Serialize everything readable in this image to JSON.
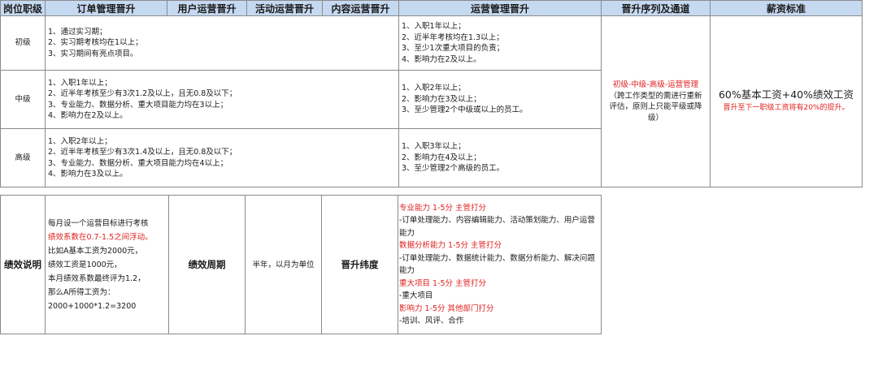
{
  "table1": {
    "headers": [
      "岗位职级",
      "订单管理晋升",
      "用户运营晋升",
      "活动运营晋升",
      "内容运营晋升",
      "运营管理晋升",
      "晋升序列及通道",
      "薪资标准"
    ],
    "rows": [
      {
        "level": "初级",
        "left": [
          "1、通过实习期；",
          "2、实习期考核均在1以上；",
          "3、实习期间有亮点项目。"
        ],
        "right": [
          "1、入职1年以上；",
          "2、近半年考核均在1.3以上；",
          "3、至少1次重大项目的负责；",
          "4、影响力在2及以上。"
        ]
      },
      {
        "level": "中级",
        "left": [
          "1、入职1年以上；",
          "2、近半年考核至少有3次1.2及以上，且无0.8及以下；",
          "3、专业能力、数据分析、重大项目能力均在3以上；",
          "4、影响力在2及以上。"
        ],
        "right": [
          "1、入职2年以上；",
          "2、影响力在3及以上；",
          "3、至少管理2个中级或以上的员工。"
        ]
      },
      {
        "level": "高级",
        "left": [
          "1、入职2年以上；",
          "2、近半年考核至少有3次1.4及以上，且无0.8及以下；",
          "3、专业能力、数据分析、重大项目能力均在4以上；",
          "4、影响力在3及以上。"
        ],
        "right": [
          "1、入职3年以上；",
          "2、影响力在4及以上；",
          "3、至少管理2个高级的员工。"
        ]
      }
    ],
    "path": {
      "title": "初级-中级-高级-运营管理",
      "note": "（跨工作类型的需进行重新评估，原则上只能平级或降级）"
    },
    "salary": {
      "main": "60%基本工资+40%绩效工资",
      "sub": "晋升至下一职级工资将有20%的提升。"
    }
  },
  "table2": {
    "label": "绩效说明",
    "desc": [
      {
        "text": "每月设一个运营目标进行考核",
        "color": "#1a1a1a"
      },
      {
        "text": "绩效系数在0.7-1.5之间浮动。",
        "color": "#e02020"
      },
      {
        "text": "比如A基本工资为2000元，",
        "color": "#1a1a1a"
      },
      {
        "text": "绩效工资是1000元，",
        "color": "#1a1a1a"
      },
      {
        "text": "本月绩效系数最终评为1.2，",
        "color": "#1a1a1a"
      },
      {
        "text": "那么A所得工资为：",
        "color": "#1a1a1a"
      },
      {
        "text": "2000+1000*1.2=3200",
        "color": "#1a1a1a"
      }
    ],
    "cycle_label": "绩效周期",
    "cycle_value": "半年，以月为单位",
    "dims_label": "晋升纬度",
    "dims": [
      {
        "text": "专业能力 1-5分 主管打分",
        "color": "#e02020"
      },
      {
        "text": "-订单处理能力、内容编辑能力、活动策划能力、用户运营能力",
        "color": "#1a1a1a"
      },
      {
        "text": "数据分析能力 1-5分 主管打分",
        "color": "#e02020"
      },
      {
        "text": "-订单处理能力、数据统计能力、数据分析能力、解决问题能力",
        "color": "#1a1a1a"
      },
      {
        "text": "重大项目 1-5分 主管打分",
        "color": "#e02020"
      },
      {
        "text": "-重大项目",
        "color": "#1a1a1a"
      },
      {
        "text": "影响力 1-5分 其他部门打分",
        "color": "#e02020"
      },
      {
        "text": "-培训、风评、合作",
        "color": "#1a1a1a"
      }
    ]
  }
}
